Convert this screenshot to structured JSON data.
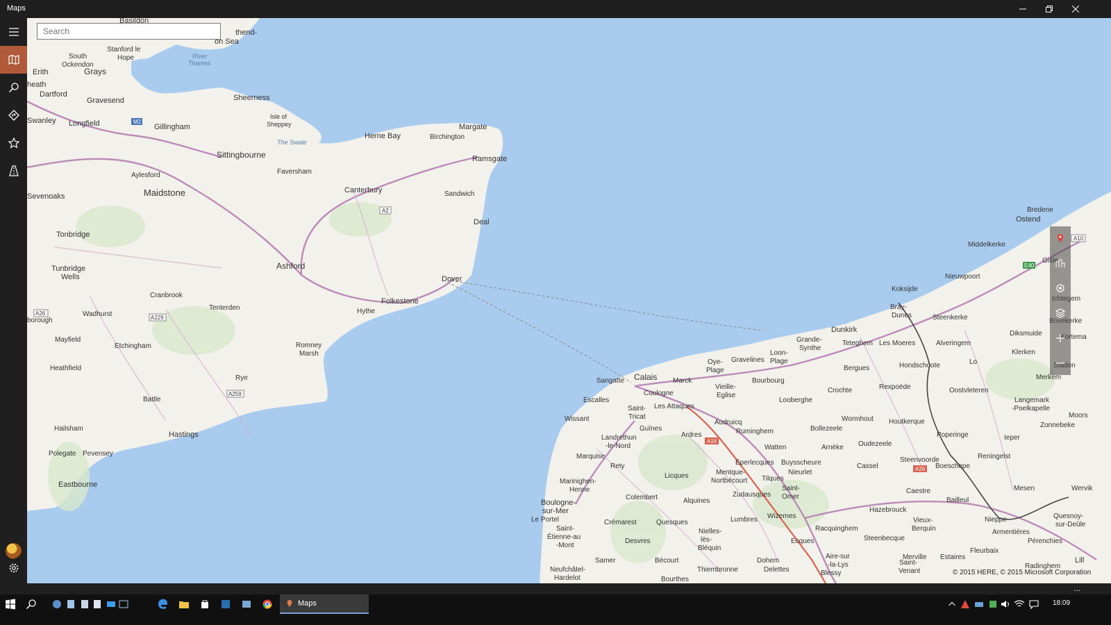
{
  "window": {
    "title": "Maps"
  },
  "search": {
    "placeholder": "Search"
  },
  "leftnav": {
    "items": [
      "menu-icon",
      "map-icon",
      "search-icon",
      "directions-icon",
      "favorites-icon",
      "traffic-icon"
    ],
    "footer": [
      "avatar",
      "settings-icon"
    ]
  },
  "map": {
    "labels": {
      "basildon": "Basildon",
      "southend": "Southend-\non Sea",
      "south_ockendon": "South\nOckendon",
      "stanford": "Stanford le\nHope",
      "river_thames": "River\nThames",
      "erith": "Erith",
      "grays": "Grays",
      "heath": "heath",
      "dartford": "Dartford",
      "gravesend": "Gravesend",
      "sheerness": "Sheerness",
      "isle_sheppey": "Isle of\nSheppey",
      "swanley": "Swanley",
      "longfield": "Longfield",
      "gillingham": "Gillingham",
      "the_swale": "The Swale",
      "herne_bay": "Herne Bay",
      "margate": "Margate",
      "birchington": "Birchington",
      "ramsgate": "Ramsgate",
      "sittingbourne": "Sittingbourne",
      "faversham": "Faversham",
      "canterbury": "Canterbury",
      "sandwich": "Sandwich",
      "aylesford": "Aylesford",
      "maidstone": "Maidstone",
      "sevenoaks": "Sevenoaks",
      "deal": "Deal",
      "tonbridge": "Tonbridge",
      "tunbridge_wells": "Tunbridge\nWells",
      "ashford": "Ashford",
      "dover": "Dover",
      "cranbrook": "Cranbrook",
      "tenterden": "Tenterden",
      "folkestone": "Folkestone",
      "hythe": "Hythe",
      "wadhurst": "Wadhurst",
      "borough": "borough",
      "mayfield": "Mayfield",
      "etchingham": "Etchingham",
      "romney_marsh": "Romney\nMarsh",
      "heathfield": "Heathfield",
      "rye": "Rye",
      "battle": "Battle",
      "hailsham": "Hailsham",
      "hastings": "Hastings",
      "polegate": "Polegate",
      "pevensey": "Pevensey",
      "eastbourne": "Eastbourne",
      "bredene": "Bredene",
      "ostend": "Ostend",
      "middelkerke": "Middelkerke",
      "nieuwpoort": "Nieuwpoort",
      "gistel": "Giste",
      "koksijde": "Koksijde",
      "ichtegem": "Ichtegem",
      "bray_dunes": "Bray-\nDunes",
      "steenkerke": "Steenkerke",
      "bovekerke": "Bovekerke",
      "dunkirk": "Dunkirk",
      "grande_synthe": "Grande-\nSynthe",
      "teteghem": "Teteghem",
      "les_moeres": "Les Moeres",
      "alveringem": "Alveringem",
      "diksmuide": "Diksmuide",
      "kortemark": "Kortema",
      "gravelines": "Gravelines",
      "loon_plage": "Loon-\nPlage",
      "oye_plage": "Oye-\nPlage",
      "bergues": "Bergues",
      "hondschoote": "Hondschoote",
      "lo": "Lo",
      "klerken": "Klerken",
      "staden": "Staden",
      "sangatte": "Sangatte",
      "calais": "Calais",
      "marck": "Marck",
      "vieille_eglise": "Vieille-\nEglise",
      "bourbourg": "Bourbourg",
      "crochte": "Crochte",
      "rexpoede": "Rexpoëde",
      "oostvleteren": "Oostvleteren",
      "merkem": "Merkem",
      "coulogne": "Coulogne",
      "escalles": "Escalles",
      "saint_tricat": "Saint-\nTricat",
      "les_attaques": "Les Attaques",
      "looberghe": "Looberghe",
      "langemark": "Langemark\n-Poelkapelle",
      "wissant": "Wissant",
      "guines": "Guînes",
      "ardres": "Ardres",
      "audruicq": "Audruicq",
      "ruminghem": "Ruminghem",
      "bollezeele": "Bollezeele",
      "wormhout": "Wormhout",
      "houtkerque": "Houtkerque",
      "poperinge": "Poperinge",
      "zonnebeke": "Zonnebeke",
      "ieper": "Ieper",
      "landrethun": "Landrethun\n-le-Nord",
      "watten": "Watten",
      "arneke": "Arnèke",
      "oudezeele": "Oudezeele",
      "moorslede": "Moors",
      "marquise": "Marquise",
      "rety": "Rety",
      "licques": "Licques",
      "eperlecques": "Éperlecques",
      "buysscheure": "Buysscheure",
      "cassel": "Cassel",
      "steenvoorde": "Steenvoorde",
      "boeschepe": "Boeschepe",
      "reningelst": "Reningelst",
      "nieurlet": "Nieurlet",
      "mentque": "Mentque-\nNortbécourt",
      "tilques": "Tilques",
      "marinhen": "Marinighen-\nHenne",
      "colembert": "Colembert",
      "alquines": "Alquines",
      "zudausques": "Zudausques",
      "saint_omer": "Saint-\nOmer",
      "caestre": "Caestre",
      "mesen": "Mesen",
      "wervik": "Wervik",
      "boulogne": "Boulogne-\nsur-Mer",
      "le_portel": "Le Portel",
      "saint_etienne": "Saint-\nÉtienne-au\n-Mont",
      "cremarest": "Crémarest",
      "quesques": "Quesques",
      "lumbres": "Lumbres",
      "wizernes": "Wizernes",
      "racquinghem": "Racquinghem",
      "hazebrouck": "Hazebrouck",
      "bailleul": "Bailleul",
      "niepe": "Nieppe",
      "vieux_berquin": "Vieux-\nBerquin",
      "armentieres": "Armentières",
      "quesnoy": "Quesnoy-\nsur-Deûle",
      "desvres": "Desvres",
      "nielles": "Nielles-\nlès-\nBléquin",
      "ecques": "Ecques",
      "steenbecque": "Steenbecque",
      "fleurbaix": "Fleurbaix",
      "perenchies": "Pérenchies",
      "samer": "Samer",
      "becourt": "Bécourt",
      "dohem": "Dohem",
      "aire": "Aire-sur\n-la-Lys",
      "merville": "Merville",
      "estaires": "Estaires",
      "radinghem": "Radinghem",
      "neufchatel": "Neufchâtel-\nHardelot",
      "thiembronne": "Thiembronne",
      "delettes": "Delettes",
      "blessy": "Blessy",
      "saint_venant": "Saint-\nVenant",
      "lille": "Lill",
      "bourthes": "Bourthes"
    },
    "road_shields": [
      "M2",
      "A2",
      "A26",
      "A229",
      "A259",
      "A10",
      "E40",
      "A16",
      "A26"
    ],
    "copyright": "© 2015 HERE, © 2015 Microsoft Corporation"
  },
  "map_controls": [
    "location-pin-icon",
    "3d-cities-icon",
    "show-my-location-icon",
    "map-layers-icon",
    "zoom-in-icon",
    "zoom-out-icon"
  ],
  "appbar": {
    "more": "..."
  },
  "taskbar": {
    "active_app": "Maps",
    "clock": "18:09"
  }
}
